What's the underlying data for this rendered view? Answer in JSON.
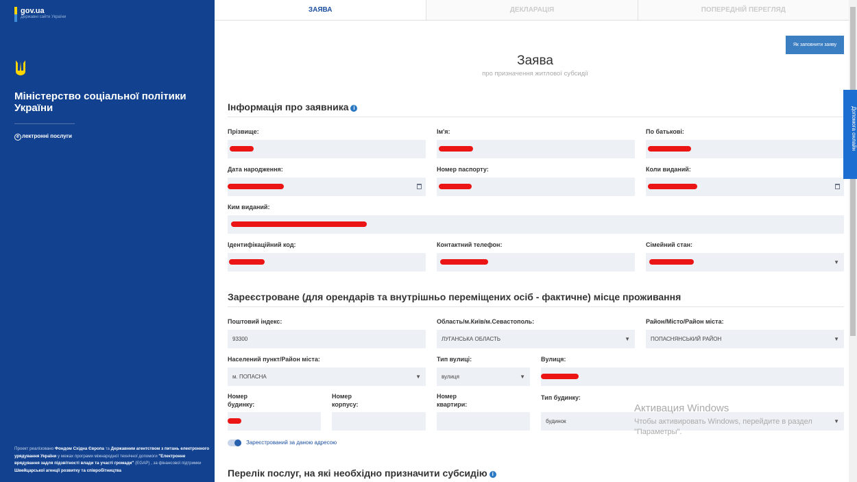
{
  "sidebar": {
    "gov_title": "gov.ua",
    "gov_sub": "Державні сайти України",
    "ministry": "Міністерство соціальної політики України",
    "eservices": "лектронні послуги",
    "e_mark": "е",
    "footnote_parts": [
      "Проект реалізовано ",
      "Фондом Східна Європа",
      " та ",
      "Державним агентством з питань електронного урядування України",
      " у межах програми міжнародної технічної допомоги ",
      "\"Електронне врядування задля підзвітності влади та участі громади\"",
      " (EGAP) , за фінансової підтримки ",
      "Швейцарської агенції розвитку та співробітництва"
    ]
  },
  "tabs": [
    "ЗАЯВА",
    "ДЕКЛАРАЦІЯ",
    "ПОПЕРЕДНІЙ ПЕРЕГЛЯД"
  ],
  "how_button": "Як заповнити заяву",
  "form": {
    "title": "Заява",
    "subtitle": "про призначення житлової субсидії",
    "sec1": "Інформація про заявника",
    "sec2": "Зареєстроване (для орендарів та внутрішньо переміщених осіб - фактичне) місце проживання",
    "sec3": "Перелік послуг, на які необхідно призначити субсидію",
    "labels": {
      "surname": "Прізвище:",
      "name": "Ім'я:",
      "patronymic": "По батькові:",
      "birth": "Дата народження:",
      "passport": "Номер паспорту:",
      "issued_date": "Коли виданий:",
      "issued_by": "Ким виданий:",
      "tax_id": "Ідентифікаційний код:",
      "phone": "Контактний телефон:",
      "family": "Сімейний стан:",
      "postal": "Поштовий індекс:",
      "oblast": "Область/м.Київ/м.Севастополь:",
      "raion": "Район/Місто/Район міста:",
      "settlement": "Населений пункт/Район міста:",
      "street_type": "Тип вулиці:",
      "street": "Вулиця:",
      "house": "Номер будинку:",
      "korpus": "Номер корпусу:",
      "apt": "Номер квартири:",
      "building_type": "Тип будинку:"
    },
    "values": {
      "postal": "93300",
      "oblast": "ЛУГАНСЬКА ОБЛАСТЬ",
      "raion": "ПОПАСНЯНСЬКИЙ РАЙОН",
      "settlement": "м. ПОПАСНА",
      "street_type": "вулиця",
      "building_type": "будинок"
    },
    "registered_toggle": "Зареєстрований за даною адресою"
  },
  "help_tab": "Допомога онлайн",
  "watermark": {
    "title": "Активация Windows",
    "text": "Чтобы активировать Windows, перейдите в раздел \"Параметры\"."
  },
  "colors": {
    "sidebar": "#12428f",
    "accent": "#1c4fa0",
    "redaction": "#ec1515"
  }
}
